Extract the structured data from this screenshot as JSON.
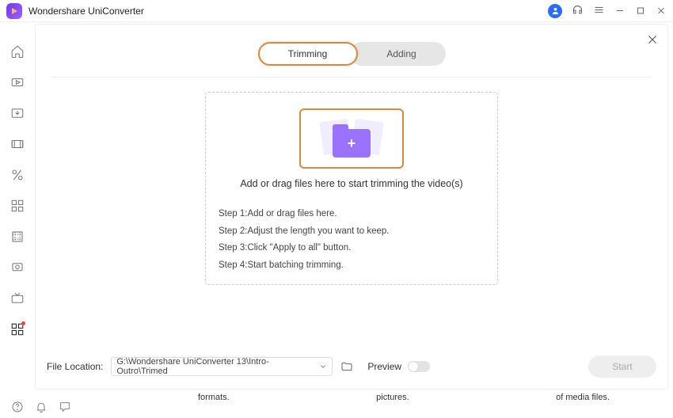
{
  "app": {
    "title": "Wondershare UniConverter"
  },
  "tabs": {
    "trimming": "Trimming",
    "adding": "Adding"
  },
  "drop": {
    "text": "Add or drag files here to start trimming the video(s)",
    "step1": "Step 1:Add or drag files here.",
    "step2": "Step 2:Adjust the length you want to keep.",
    "step3": "Step 3:Click \"Apply to all\" button.",
    "step4": "Step 4:Start batching trimming."
  },
  "bottom": {
    "fileloc_label": "File Location:",
    "path": "G:\\Wondershare UniConverter 13\\Intro-Outro\\Trimed",
    "preview_label": "Preview",
    "start_label": "Start"
  },
  "bg": {
    "a": "formats.",
    "b": "pictures.",
    "c": "of media files."
  }
}
